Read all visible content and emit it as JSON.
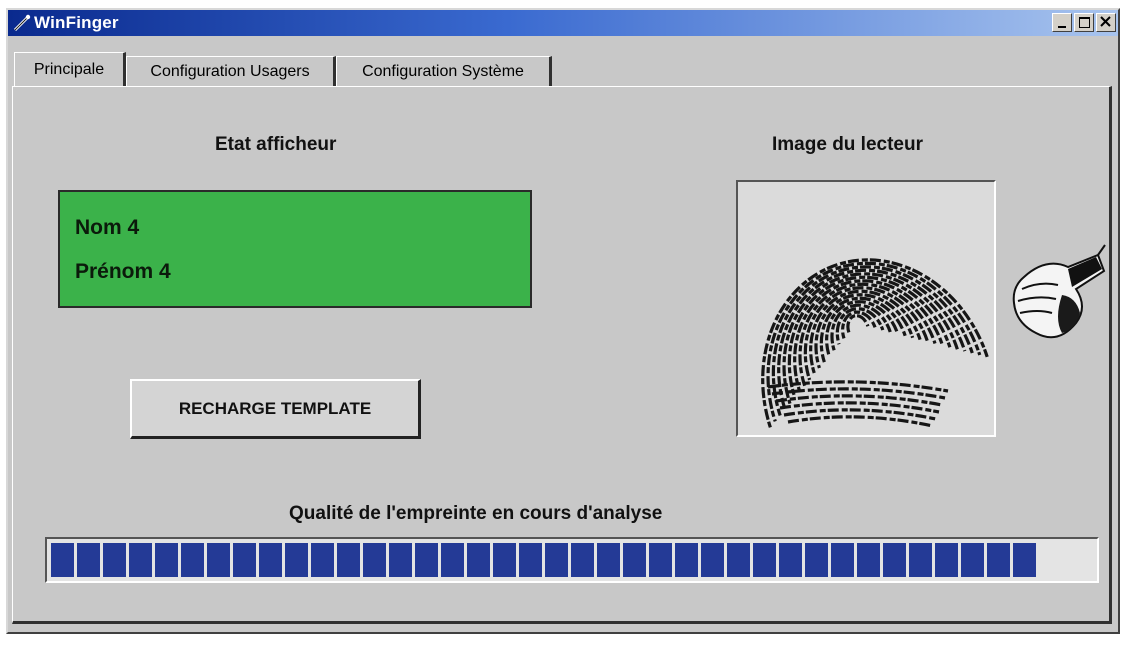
{
  "window": {
    "title": "WinFinger"
  },
  "tabs": [
    {
      "label": "Principale",
      "active": true
    },
    {
      "label": "Configuration Usagers",
      "active": false
    },
    {
      "label": "Configuration Système",
      "active": false
    }
  ],
  "display": {
    "heading": "Etat afficheur",
    "line1": "Nom 4",
    "line2": "Prénom 4",
    "background_color": "#3bb24a"
  },
  "reader": {
    "heading": "Image du lecteur",
    "icon": "hand-on-fingerprint-reader-icon"
  },
  "actions": {
    "reload_label": "RECHARGE TEMPLATE"
  },
  "quality": {
    "label": "Qualité de l'empreinte en cours d'analyse",
    "value_fraction": 0.96,
    "bar_color": "#243a96"
  }
}
